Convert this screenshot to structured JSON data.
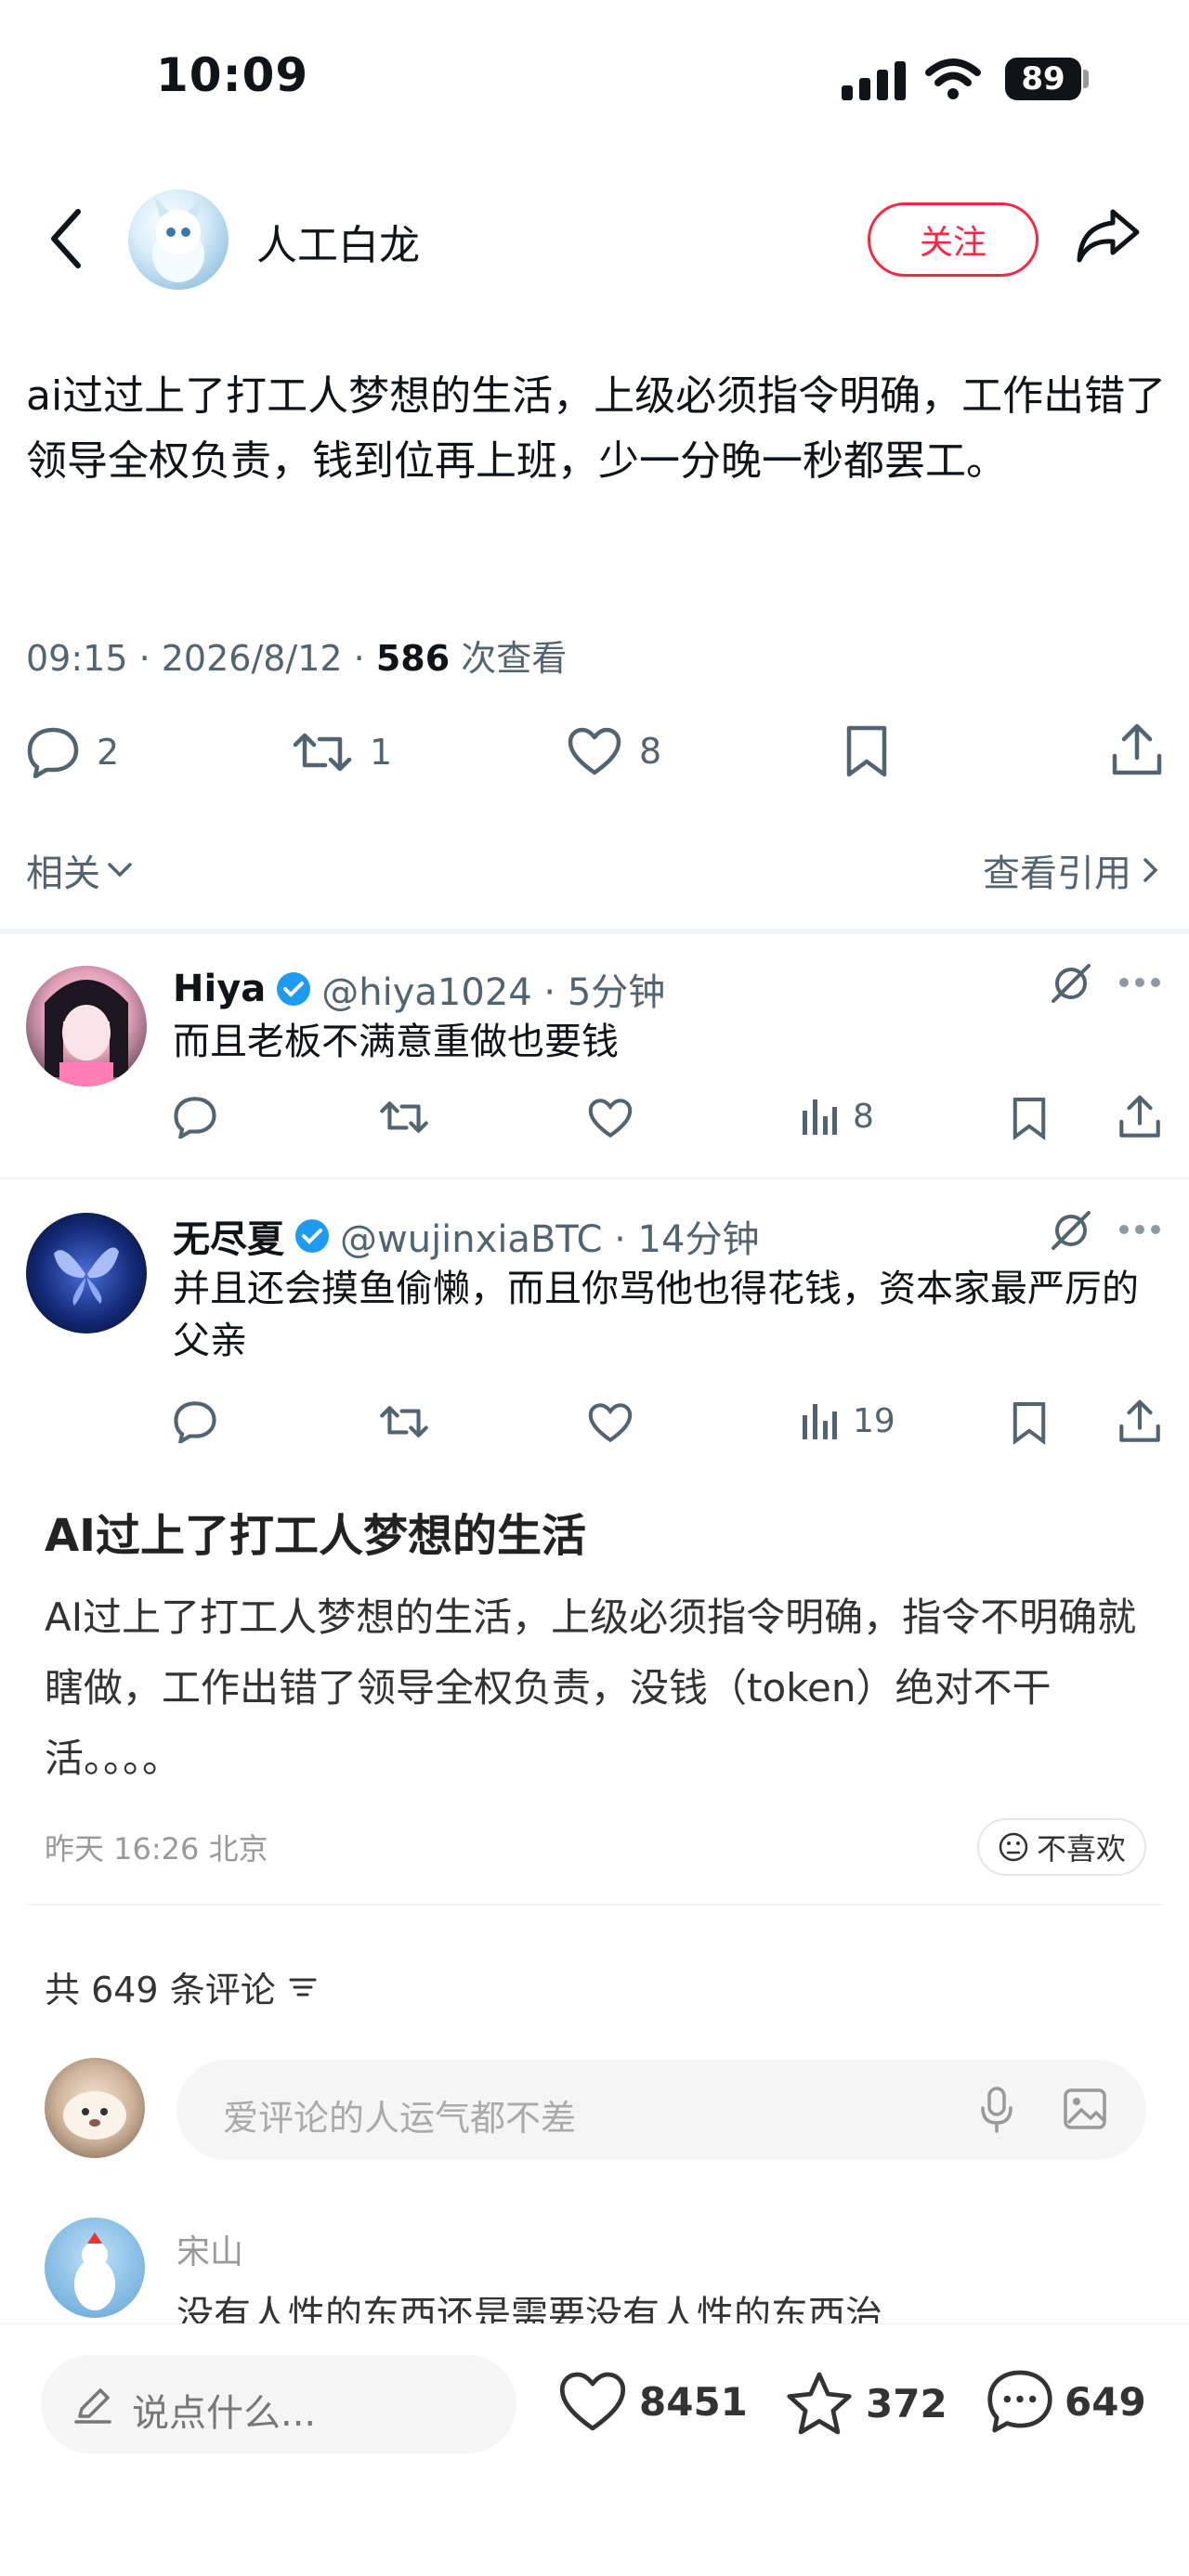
{
  "status_bar": {
    "time": "10:09",
    "battery": "89"
  },
  "header": {
    "username": "人工白龙",
    "follow_label": "关注"
  },
  "post": {
    "text": "ai过过上了打工人梦想的生活，上级必须指令明确，工作出错了领导全权负责，钱到位再上班，少一分晚一秒都罢工。",
    "time": "09:15 · 2026/8/12 · ",
    "views": "586",
    "views_label": " 次查看",
    "stats": {
      "replies": "2",
      "retweets": "1",
      "likes": "8"
    }
  },
  "related": {
    "label": "相关",
    "quote_label": "查看引用"
  },
  "replies": [
    {
      "name": "Hiya",
      "handle": "@hiya1024 · 5分钟",
      "text": "而且老板不满意重做也要钱",
      "views": "8"
    },
    {
      "name": "无尽夏",
      "handle": "@wujinxiaBTC · 14分钟",
      "text": "并且还会摸鱼偷懒，而且你骂他也得花钱，资本家最严厉的父亲",
      "views": "19"
    }
  ],
  "article": {
    "title": "AI过上了打工人梦想的生活",
    "body": "AI过上了打工人梦想的生活，上级必须指令明确，指令不明确就瞎做，工作出错了领导全权负责，没钱（token）绝对不干活。。。。",
    "meta": "昨天 16:26 北京",
    "dislike_label": "不喜欢"
  },
  "comments": {
    "count_label": "共 649 条评论",
    "input_placeholder": "爱评论的人运气都不差",
    "first": {
      "name": "宋山",
      "text": "没有人性的东西还是需要没有人性的东西治"
    }
  },
  "bottom_bar": {
    "say_placeholder": "说点什么...",
    "likes": "8451",
    "stars": "372",
    "comments": "649"
  },
  "colors": {
    "accent": "#ff2442",
    "verified": "#1d9bf0",
    "muted": "#536471"
  }
}
